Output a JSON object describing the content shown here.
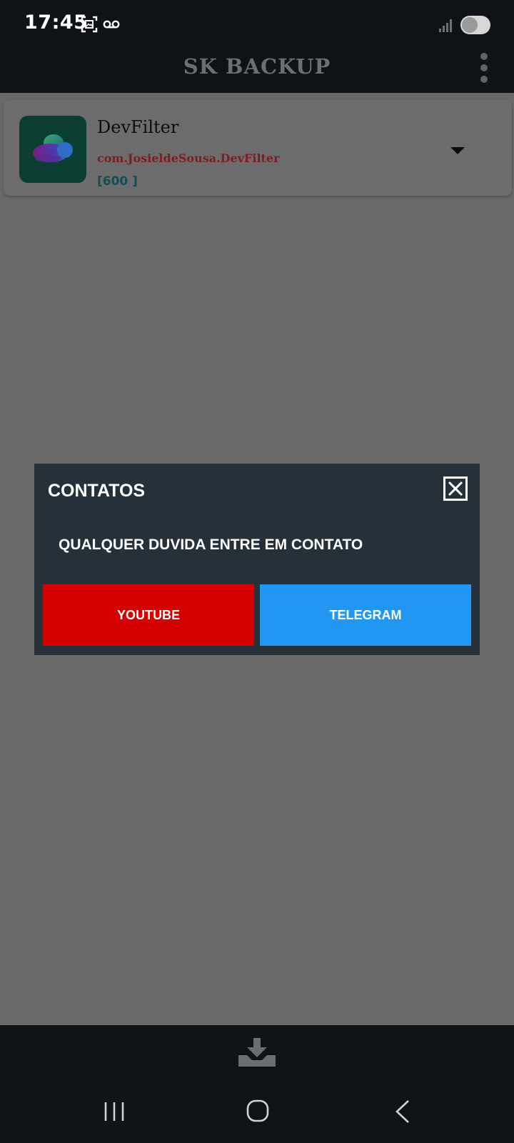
{
  "status_bar": {
    "time": "17:45",
    "icons": [
      "screenshot-icon",
      "voicemail-icon",
      "signal-icon",
      "battery-icon"
    ]
  },
  "app_bar": {
    "title": "SK BACKUP",
    "menu_icon": "more-vert-icon"
  },
  "app_list": [
    {
      "name": "DevFilter",
      "package": "com.JosieldeSousa.DevFilter",
      "version": "[600 ]",
      "icon": "devfilter-app-icon"
    }
  ],
  "dialog": {
    "title": "CONTATOS",
    "message": "QUALQUER DUVIDA ENTRE EM CONTATO",
    "buttons": {
      "youtube": "YOUTUBE",
      "telegram": "TELEGRAM"
    },
    "close_icon": "close-icon"
  },
  "bottom_bar": {
    "action_icon": "download-icon"
  },
  "navigation": {
    "recents_icon": "recents-icon",
    "home_icon": "home-icon",
    "back_icon": "back-icon"
  },
  "colors": {
    "background": "#0f1317",
    "overlay": "#6a6a6a",
    "dialog_bg": "#263039",
    "youtube": "#d50000",
    "telegram": "#2196f3",
    "package_text": "#7c1d1f",
    "version_text": "#0f4f54"
  }
}
